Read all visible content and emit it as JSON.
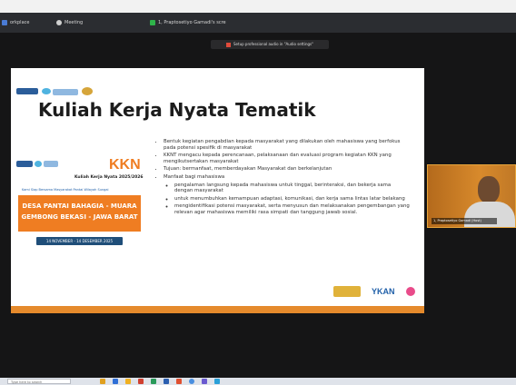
{
  "tabs": [
    {
      "label": "orkplace",
      "color": "#4a7bd4"
    },
    {
      "label": "Meeting",
      "color": "#d0d0d0"
    },
    {
      "label": "1, Praptosetiyo Gamadi's scre",
      "color": "#2fb34a"
    }
  ],
  "notice": {
    "text": "Setup professional audio in \"Audio settings\""
  },
  "slide": {
    "title": "Kuliah Kerja Nyata Tematik",
    "poster": {
      "kkn": "KKN",
      "year_line": "Kuliah Kerja Nyata 2025/2026",
      "tagline": "Kami Siap Bersama Masyarakat Pantai Wilayah Sungai",
      "desa_line1": "DESA PANTAI BAHAGIA - MUARA",
      "desa_line2": "GEMBONG BEKASI - JAWA BARAT",
      "date": "14 NOVEMBER - 14 DESEMBER 2025"
    },
    "bullets": [
      "Bentuk kegiatan pengabdian kepada masyarakat yang dilakukan oleh mahasiswa yang berfokus pada potensi spesifik di masyarakat",
      "KKNT mengacu kepada perencanaan, pelaksanaan dan evaluasi program kegiatan KKN yang mengikutsertakan masyarakat",
      "Tujuan: bermanfaat, memberdayakan Masyarakat dan berkelanjutan",
      "Manfaat bagi mahasiswa"
    ],
    "sub_bullets": [
      "pengalaman langsung kepada mahasiswa untuk tinggal, berinteraksi, dan bekerja sama dengan masyarakat",
      "untuk menumbuhkan kemampuan adaptasi, komunikasi, dan kerja sama lintas latar belakang",
      "mengidentifikasi potensi masyarakat, serta menyusun dan melaksanakan pengembangan yang relevan agar mahasiswa memiliki rasa simpati dan tanggung jawab sosial."
    ],
    "bottom_logo_text": "YKAN"
  },
  "participant": {
    "name": "1, Praptosetiyo Gamadi (Host)"
  },
  "taskbar": {
    "search_placeholder": "Type here to search"
  }
}
